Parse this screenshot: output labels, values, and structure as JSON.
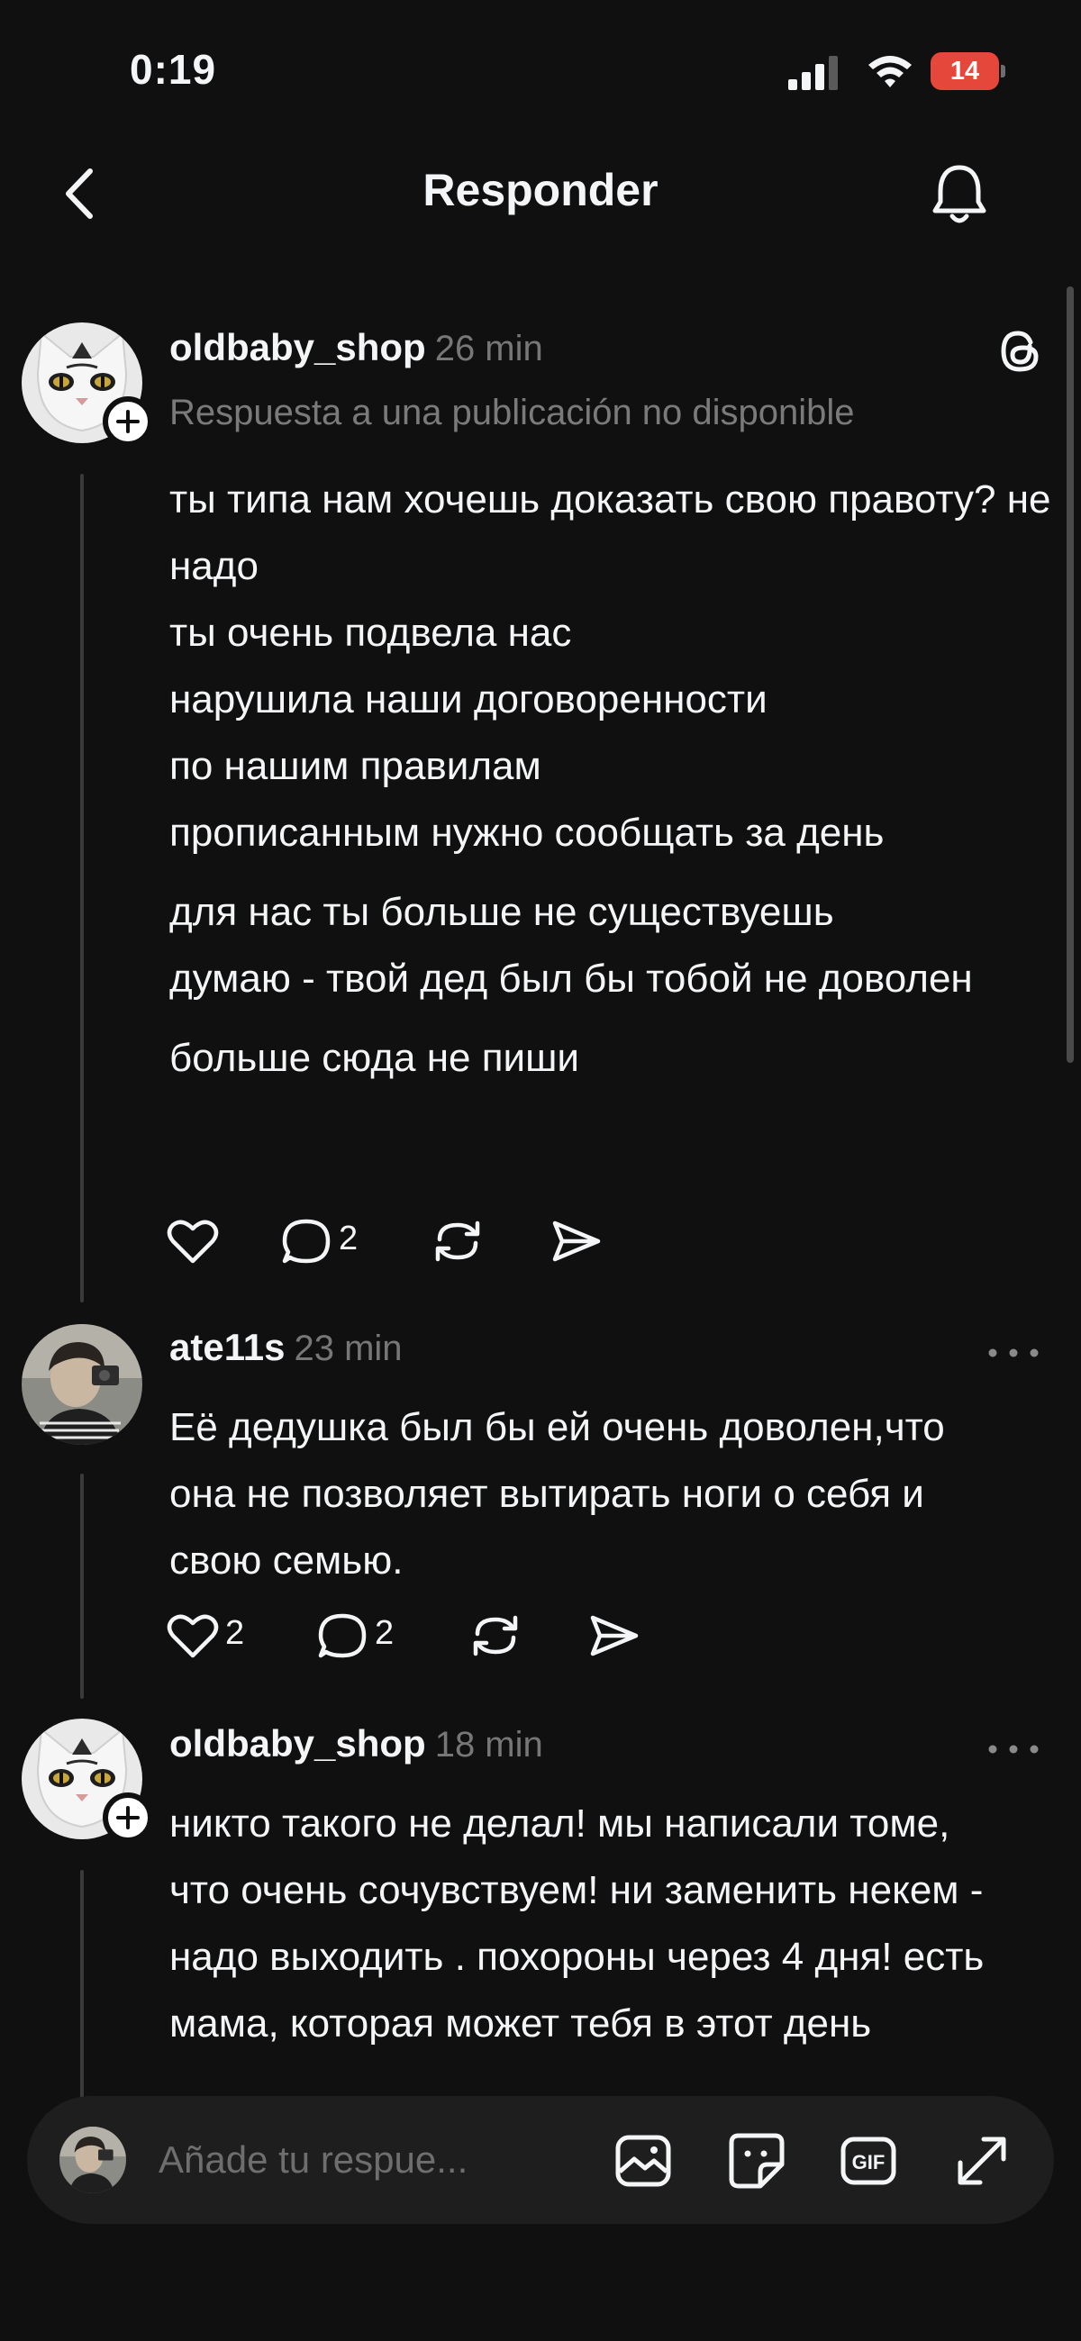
{
  "status_bar": {
    "time": "0:19",
    "battery": "14"
  },
  "header": {
    "title": "Responder"
  },
  "posts": [
    {
      "username": "oldbaby_shop",
      "time": "26 min",
      "reply_note": "Respuesta a una publicación no disponible",
      "paragraphs": [
        "ты типа нам хочешь доказать свою правоту? не надо\nты очень подвела нас\nнарушила наши договоренности\nпо нашим правилам\nпрописанным нужно сообщать за день",
        "для нас ты больше не существуешь\nдумаю - твой дед был бы тобой  не доволен",
        "больше сюда не пиши"
      ],
      "likes": "",
      "replies": "2"
    },
    {
      "username": "ate11s",
      "time": "23 min",
      "paragraphs": [
        "Её дедушка был бы ей очень доволен,что она не позволяет вытирать ноги о себя и свою семью."
      ],
      "likes": "2",
      "replies": "2"
    },
    {
      "username": "oldbaby_shop",
      "time": "18 min",
      "paragraphs": [
        "никто такого не делал! мы написали томе, что очень сочувствуем! ни заменить некем - надо выходить . похороны через 4 дня! есть мама, которая может тебя в этот день"
      ]
    }
  ],
  "composer": {
    "placeholder": "Añade tu respue..."
  },
  "colors": {
    "background": "#101010",
    "text": "#f3f5f7",
    "muted": "#777777",
    "battery": "#e5473a"
  }
}
